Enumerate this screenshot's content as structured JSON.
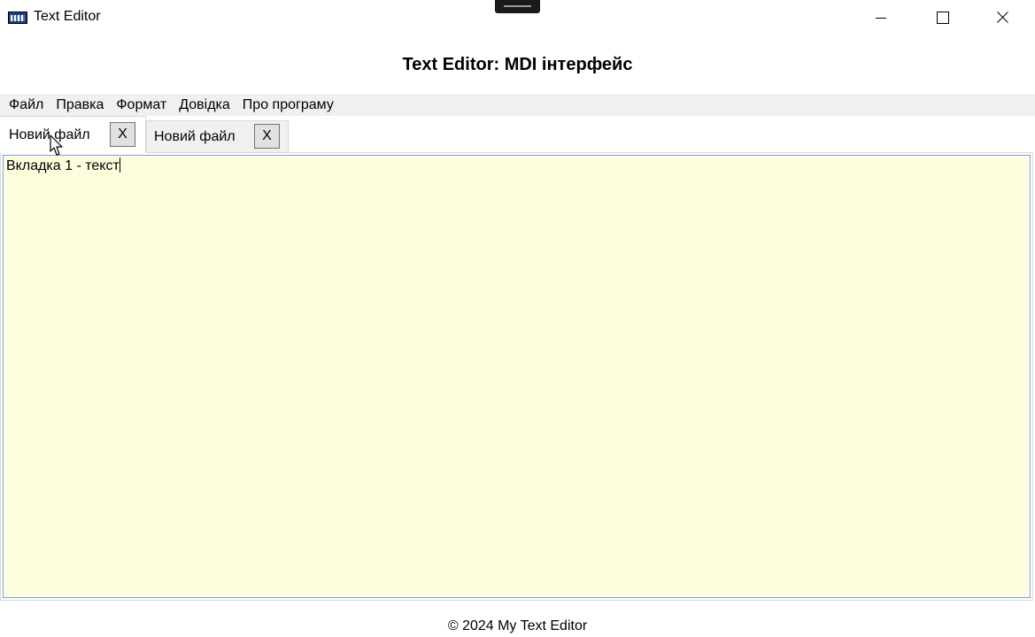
{
  "window": {
    "title": "Text Editor"
  },
  "header": {
    "title": "Text Editor: MDI інтерфейс"
  },
  "menu": {
    "items": [
      {
        "label": "Файл"
      },
      {
        "label": "Правка"
      },
      {
        "label": "Формат"
      },
      {
        "label": "Довідка"
      },
      {
        "label": "Про програму"
      }
    ]
  },
  "tabs": [
    {
      "label": "Новий файл",
      "close": "X",
      "active": true
    },
    {
      "label": "Новий файл",
      "close": "X",
      "active": false
    }
  ],
  "editor": {
    "content": "Вкладка 1 - текст"
  },
  "footer": {
    "text": "© 2024 My Text Editor"
  },
  "icons": {
    "app": "text-editor-app-icon",
    "minimize": "minimize-icon",
    "maximize": "maximize-icon",
    "close": "close-icon",
    "cursor": "mouse-pointer-icon"
  },
  "colors": {
    "editor_background": "#fefdde",
    "editor_border": "#6fa9e0",
    "menubar_background": "#f0f0f0"
  }
}
